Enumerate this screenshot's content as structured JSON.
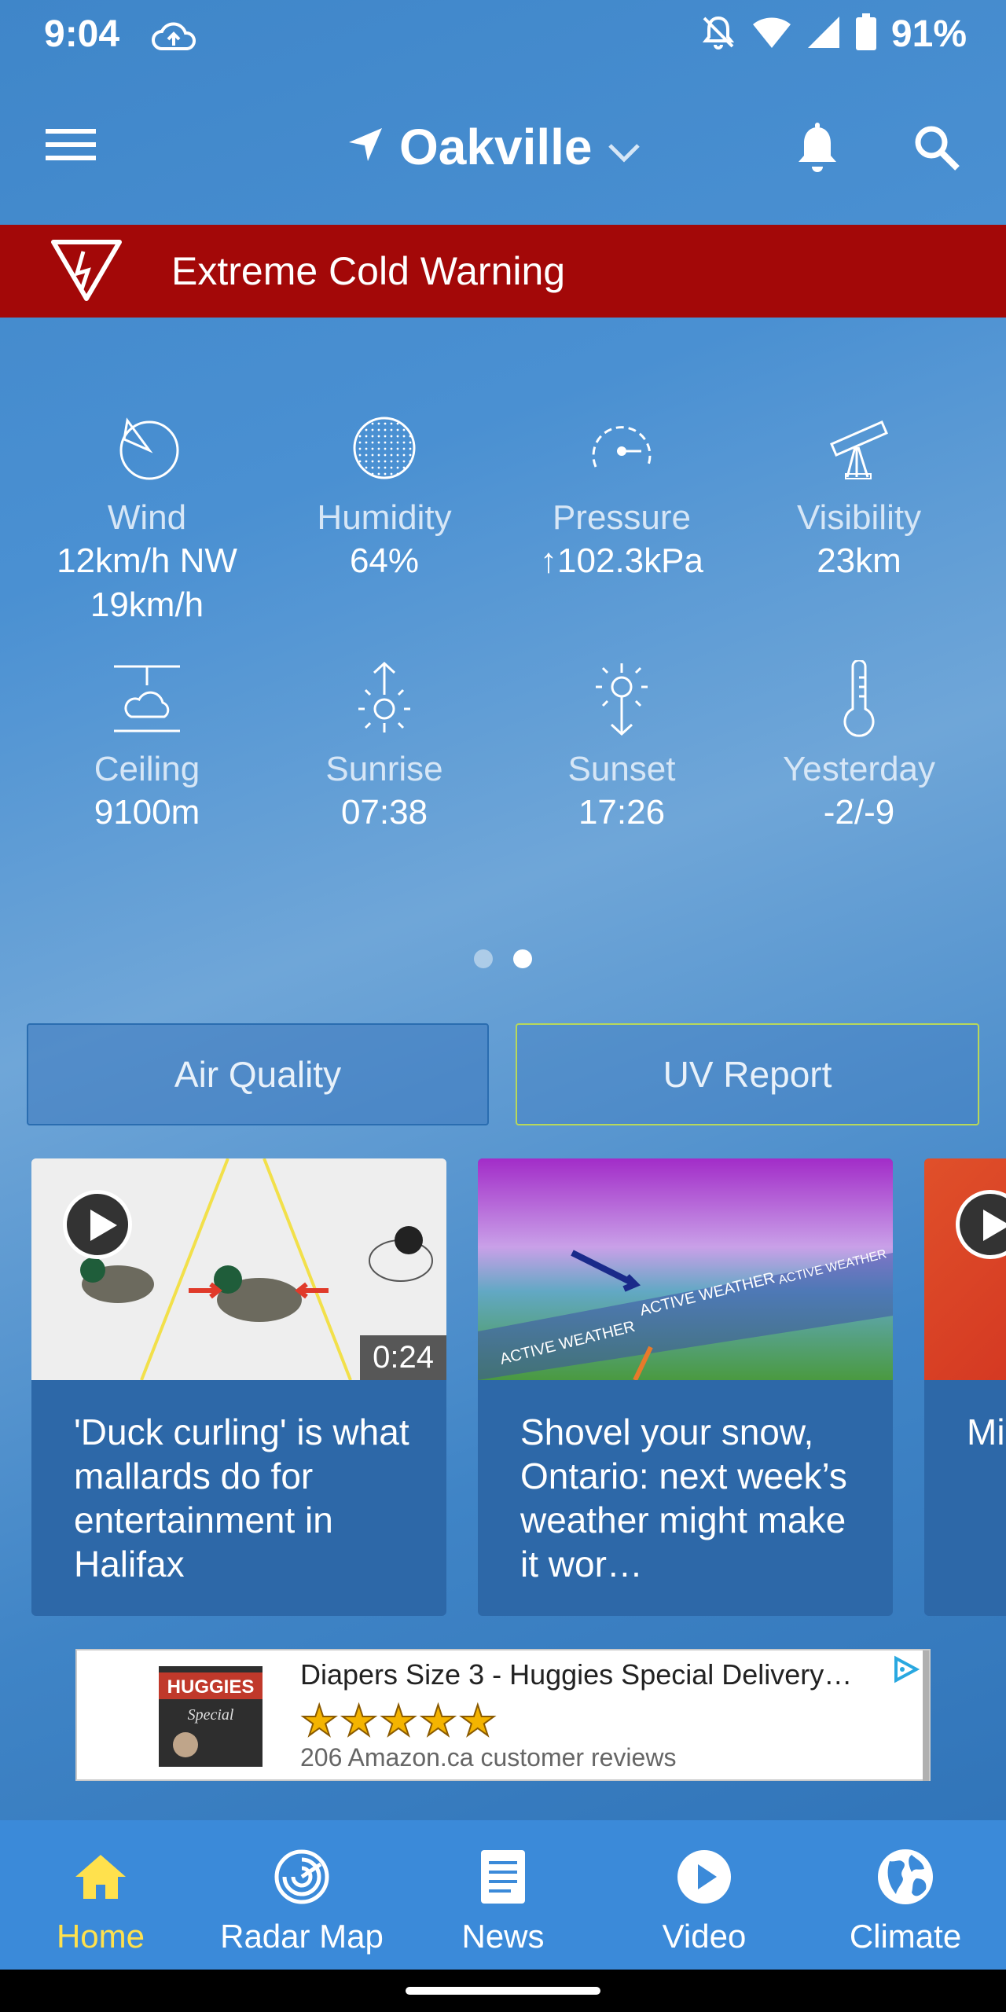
{
  "status_bar": {
    "time": "9:04",
    "battery": "91%"
  },
  "header": {
    "location": "Oakville"
  },
  "alert": {
    "text": "Extreme Cold Warning"
  },
  "conditions": [
    {
      "label": "Wind",
      "value": "12km/h NW",
      "value2": "19km/h",
      "icon": "wind-icon"
    },
    {
      "label": "Humidity",
      "value": "64%",
      "icon": "humidity-icon"
    },
    {
      "label": "Pressure",
      "value": "102.3kPa",
      "trend": "rising",
      "icon": "pressure-gauge-icon"
    },
    {
      "label": "Visibility",
      "value": "23km",
      "icon": "telescope-icon"
    },
    {
      "label": "Ceiling",
      "value": "9100m",
      "icon": "cloud-ceiling-icon"
    },
    {
      "label": "Sunrise",
      "value": "07:38",
      "icon": "sunrise-icon"
    },
    {
      "label": "Sunset",
      "value": "17:26",
      "icon": "sunset-icon"
    },
    {
      "label": "Yesterday",
      "value": "-2/-9",
      "icon": "thermometer-icon"
    }
  ],
  "pager": {
    "pages": 2,
    "active": 2
  },
  "buttons": {
    "air_quality": "Air Quality",
    "uv_report": "UV Report"
  },
  "cards": [
    {
      "title": "'Duck curling' is what mallards do for entertainment in Halifax",
      "duration": "0:24",
      "video": true
    },
    {
      "title": "Shovel your snow, Ontario: next week’s weather might make it wor…",
      "video": false,
      "thumb_text": [
        "ACTIVE WEATHER",
        "ACTIVE WEATHER",
        "ACTIVE WEATHER"
      ]
    },
    {
      "title": "Mi im po bo",
      "video": true
    }
  ],
  "ad": {
    "title": "Diapers Size 3 - Huggies Special Delivery…",
    "stars": "★★★★★",
    "reviews": "206 Amazon.ca customer reviews",
    "brand": "HUGGIES",
    "brand_sub": "Special"
  },
  "bottom_nav": [
    {
      "label": "Home",
      "icon": "home-icon",
      "active": true
    },
    {
      "label": "Radar Map",
      "icon": "radar-icon",
      "active": false
    },
    {
      "label": "News",
      "icon": "news-icon",
      "active": false
    },
    {
      "label": "Video",
      "icon": "video-play-icon",
      "active": false
    },
    {
      "label": "Climate",
      "icon": "globe-icon",
      "active": false
    }
  ],
  "colors": {
    "alert_red": "#a30808",
    "nav_blue": "#3b8ad9",
    "active_yellow": "#ffe14d",
    "uv_border": "#b8d85a"
  }
}
